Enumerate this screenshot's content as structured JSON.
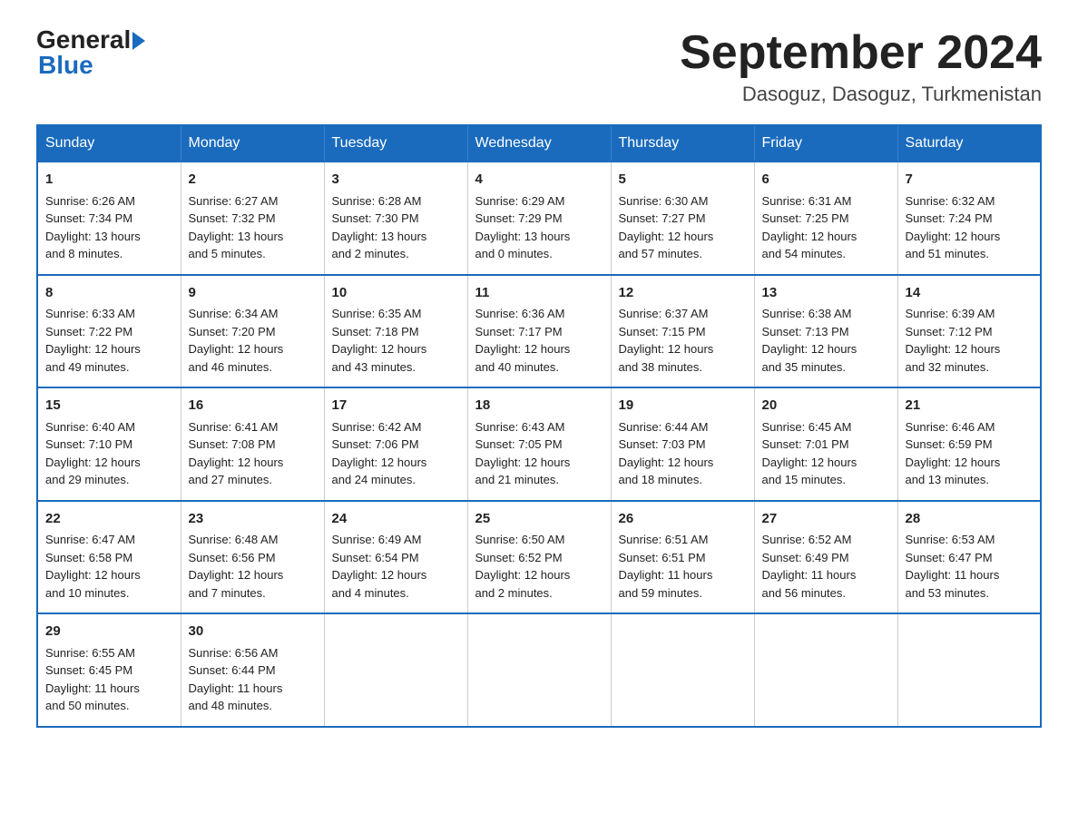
{
  "logo": {
    "general": "General",
    "blue": "Blue",
    "arrow": "▶"
  },
  "title": "September 2024",
  "subtitle": "Dasoguz, Dasoguz, Turkmenistan",
  "days_of_week": [
    "Sunday",
    "Monday",
    "Tuesday",
    "Wednesday",
    "Thursday",
    "Friday",
    "Saturday"
  ],
  "weeks": [
    [
      {
        "day": "1",
        "info": "Sunrise: 6:26 AM\nSunset: 7:34 PM\nDaylight: 13 hours\nand 8 minutes."
      },
      {
        "day": "2",
        "info": "Sunrise: 6:27 AM\nSunset: 7:32 PM\nDaylight: 13 hours\nand 5 minutes."
      },
      {
        "day": "3",
        "info": "Sunrise: 6:28 AM\nSunset: 7:30 PM\nDaylight: 13 hours\nand 2 minutes."
      },
      {
        "day": "4",
        "info": "Sunrise: 6:29 AM\nSunset: 7:29 PM\nDaylight: 13 hours\nand 0 minutes."
      },
      {
        "day": "5",
        "info": "Sunrise: 6:30 AM\nSunset: 7:27 PM\nDaylight: 12 hours\nand 57 minutes."
      },
      {
        "day": "6",
        "info": "Sunrise: 6:31 AM\nSunset: 7:25 PM\nDaylight: 12 hours\nand 54 minutes."
      },
      {
        "day": "7",
        "info": "Sunrise: 6:32 AM\nSunset: 7:24 PM\nDaylight: 12 hours\nand 51 minutes."
      }
    ],
    [
      {
        "day": "8",
        "info": "Sunrise: 6:33 AM\nSunset: 7:22 PM\nDaylight: 12 hours\nand 49 minutes."
      },
      {
        "day": "9",
        "info": "Sunrise: 6:34 AM\nSunset: 7:20 PM\nDaylight: 12 hours\nand 46 minutes."
      },
      {
        "day": "10",
        "info": "Sunrise: 6:35 AM\nSunset: 7:18 PM\nDaylight: 12 hours\nand 43 minutes."
      },
      {
        "day": "11",
        "info": "Sunrise: 6:36 AM\nSunset: 7:17 PM\nDaylight: 12 hours\nand 40 minutes."
      },
      {
        "day": "12",
        "info": "Sunrise: 6:37 AM\nSunset: 7:15 PM\nDaylight: 12 hours\nand 38 minutes."
      },
      {
        "day": "13",
        "info": "Sunrise: 6:38 AM\nSunset: 7:13 PM\nDaylight: 12 hours\nand 35 minutes."
      },
      {
        "day": "14",
        "info": "Sunrise: 6:39 AM\nSunset: 7:12 PM\nDaylight: 12 hours\nand 32 minutes."
      }
    ],
    [
      {
        "day": "15",
        "info": "Sunrise: 6:40 AM\nSunset: 7:10 PM\nDaylight: 12 hours\nand 29 minutes."
      },
      {
        "day": "16",
        "info": "Sunrise: 6:41 AM\nSunset: 7:08 PM\nDaylight: 12 hours\nand 27 minutes."
      },
      {
        "day": "17",
        "info": "Sunrise: 6:42 AM\nSunset: 7:06 PM\nDaylight: 12 hours\nand 24 minutes."
      },
      {
        "day": "18",
        "info": "Sunrise: 6:43 AM\nSunset: 7:05 PM\nDaylight: 12 hours\nand 21 minutes."
      },
      {
        "day": "19",
        "info": "Sunrise: 6:44 AM\nSunset: 7:03 PM\nDaylight: 12 hours\nand 18 minutes."
      },
      {
        "day": "20",
        "info": "Sunrise: 6:45 AM\nSunset: 7:01 PM\nDaylight: 12 hours\nand 15 minutes."
      },
      {
        "day": "21",
        "info": "Sunrise: 6:46 AM\nSunset: 6:59 PM\nDaylight: 12 hours\nand 13 minutes."
      }
    ],
    [
      {
        "day": "22",
        "info": "Sunrise: 6:47 AM\nSunset: 6:58 PM\nDaylight: 12 hours\nand 10 minutes."
      },
      {
        "day": "23",
        "info": "Sunrise: 6:48 AM\nSunset: 6:56 PM\nDaylight: 12 hours\nand 7 minutes."
      },
      {
        "day": "24",
        "info": "Sunrise: 6:49 AM\nSunset: 6:54 PM\nDaylight: 12 hours\nand 4 minutes."
      },
      {
        "day": "25",
        "info": "Sunrise: 6:50 AM\nSunset: 6:52 PM\nDaylight: 12 hours\nand 2 minutes."
      },
      {
        "day": "26",
        "info": "Sunrise: 6:51 AM\nSunset: 6:51 PM\nDaylight: 11 hours\nand 59 minutes."
      },
      {
        "day": "27",
        "info": "Sunrise: 6:52 AM\nSunset: 6:49 PM\nDaylight: 11 hours\nand 56 minutes."
      },
      {
        "day": "28",
        "info": "Sunrise: 6:53 AM\nSunset: 6:47 PM\nDaylight: 11 hours\nand 53 minutes."
      }
    ],
    [
      {
        "day": "29",
        "info": "Sunrise: 6:55 AM\nSunset: 6:45 PM\nDaylight: 11 hours\nand 50 minutes."
      },
      {
        "day": "30",
        "info": "Sunrise: 6:56 AM\nSunset: 6:44 PM\nDaylight: 11 hours\nand 48 minutes."
      },
      {
        "day": "",
        "info": ""
      },
      {
        "day": "",
        "info": ""
      },
      {
        "day": "",
        "info": ""
      },
      {
        "day": "",
        "info": ""
      },
      {
        "day": "",
        "info": ""
      }
    ]
  ]
}
